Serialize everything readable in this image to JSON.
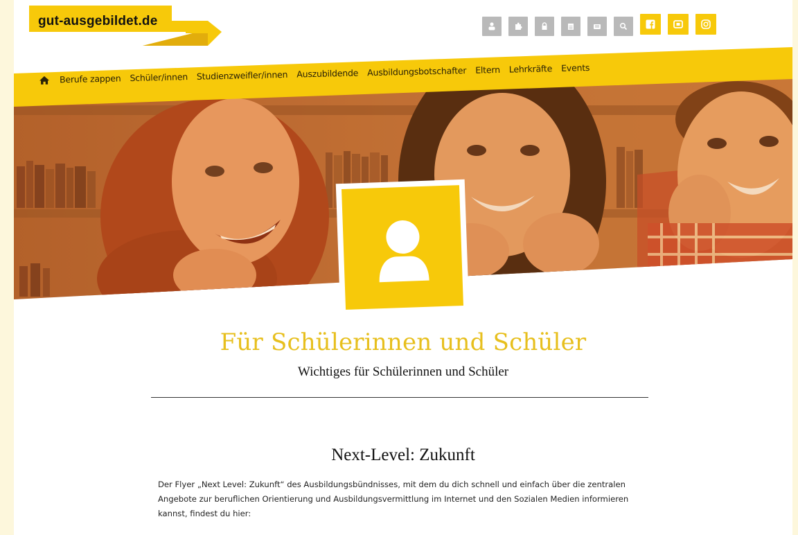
{
  "logo": {
    "text": "gut-ausgebildet.de"
  },
  "top_icons": [
    {
      "name": "user-group-icon",
      "style": "grey"
    },
    {
      "name": "puzzle-icon",
      "style": "grey"
    },
    {
      "name": "lock-icon",
      "style": "grey"
    },
    {
      "name": "calendar-icon",
      "style": "grey"
    },
    {
      "name": "newspaper-icon",
      "style": "grey"
    },
    {
      "name": "search-icon",
      "style": "grey"
    },
    {
      "name": "facebook-icon",
      "style": "yellow"
    },
    {
      "name": "youtube-icon",
      "style": "yellow"
    },
    {
      "name": "instagram-icon",
      "style": "yellow"
    }
  ],
  "nav": {
    "home_icon": "home-icon",
    "items": [
      "Berufe zappen",
      "Schüler/innen",
      "Studienzweifler/innen",
      "Auszubildende",
      "Ausbildungsbotschafter",
      "Eltern",
      "Lehrkräfte",
      "Events"
    ]
  },
  "badge": {
    "icon": "user-icon"
  },
  "content": {
    "title": "Für Schülerinnen und Schüler",
    "subtitle": "Wichtiges für Schülerinnen und Schüler",
    "section_title": "Next-Level: Zukunft",
    "paragraph": "Der Flyer „Next Level: Zukunft“ des Ausbildungsbündnisses, mit dem du dich schnell und einfach über die zentralen Angebote zur beruflichen Orientierung und Ausbildungsvermittlung im Internet und den Sozialen Medien informieren kannst, findest du hier:"
  },
  "colors": {
    "accent": "#f7c90a",
    "background": "#fdf7dc",
    "icon_grey": "#b9b9b9",
    "title": "#e7bf1d"
  }
}
